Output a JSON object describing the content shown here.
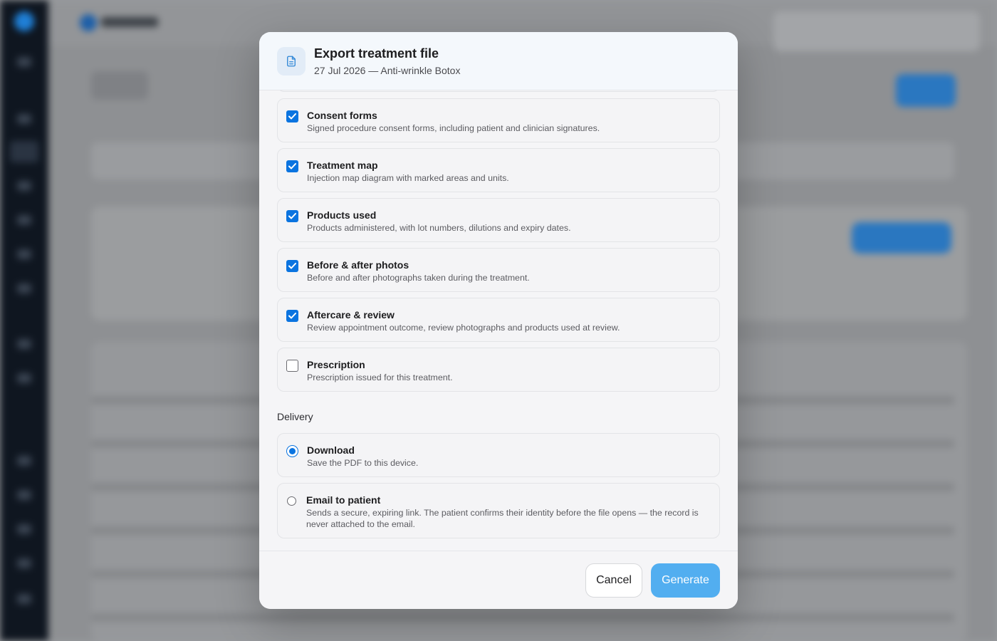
{
  "modal": {
    "title": "Export treatment file",
    "subtitle": "27 Jul 2026 — Anti-wrinkle Botox"
  },
  "options": [
    {
      "title": "Consent forms",
      "description": "Signed procedure consent forms, including patient and clinician signatures.",
      "checked": true
    },
    {
      "title": "Treatment map",
      "description": "Injection map diagram with marked areas and units.",
      "checked": true
    },
    {
      "title": "Products used",
      "description": "Products administered, with lot numbers, dilutions and expiry dates.",
      "checked": true
    },
    {
      "title": "Before & after photos",
      "description": "Before and after photographs taken during the treatment.",
      "checked": true
    },
    {
      "title": "Aftercare & review",
      "description": "Review appointment outcome, review photographs and products used at review.",
      "checked": true
    },
    {
      "title": "Prescription",
      "description": "Prescription issued for this treatment.",
      "checked": false
    }
  ],
  "delivery": {
    "label": "Delivery",
    "options": [
      {
        "title": "Download",
        "description": "Save the PDF to this device.",
        "selected": true
      },
      {
        "title": "Email to patient",
        "description": "Sends a secure, expiring link. The patient confirms their identity before the file opens — the record is never attached to the email.",
        "selected": false
      }
    ]
  },
  "footer": {
    "cancel_label": "Cancel",
    "generate_label": "Generate"
  },
  "colors": {
    "accent": "#0b74e0",
    "generate_button": "#52aef0"
  }
}
